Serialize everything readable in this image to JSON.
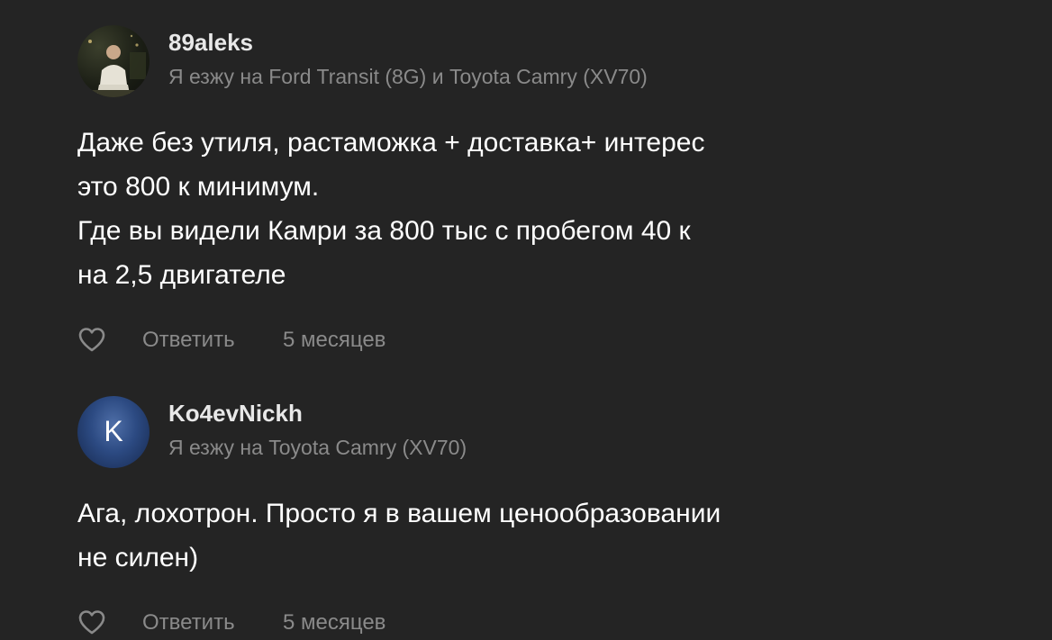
{
  "comments": [
    {
      "username": "89aleks",
      "cars": "Я езжу на Ford Transit (8G) и Toyota Camry (XV70)",
      "avatar": {
        "type": "photo",
        "icon": "user-photo-avatar"
      },
      "lines": [
        "Даже без утиля, растаможка + доставка+ интерес",
        "это 800 к минимум.",
        "Где вы видели Камри за 800 тыс с пробегом 40 к",
        "на 2,5 двигателе"
      ],
      "like_icon": "heart-outline-icon",
      "reply_label": "Ответить",
      "time": "5 месяцев"
    },
    {
      "username": "Ko4evNickh",
      "cars": "Я езжу на Toyota Camry (XV70)",
      "avatar": {
        "type": "letter",
        "letter": "K",
        "color": "#2c4a82"
      },
      "lines": [
        "Ага, лохотрон. Просто я в вашем ценообразовании",
        "не силен)"
      ],
      "like_icon": "heart-outline-icon",
      "reply_label": "Ответить",
      "time": "5 месяцев"
    }
  ],
  "colors": {
    "background": "#242424",
    "text": "#ffffff",
    "muted": "#8a8a8a"
  }
}
